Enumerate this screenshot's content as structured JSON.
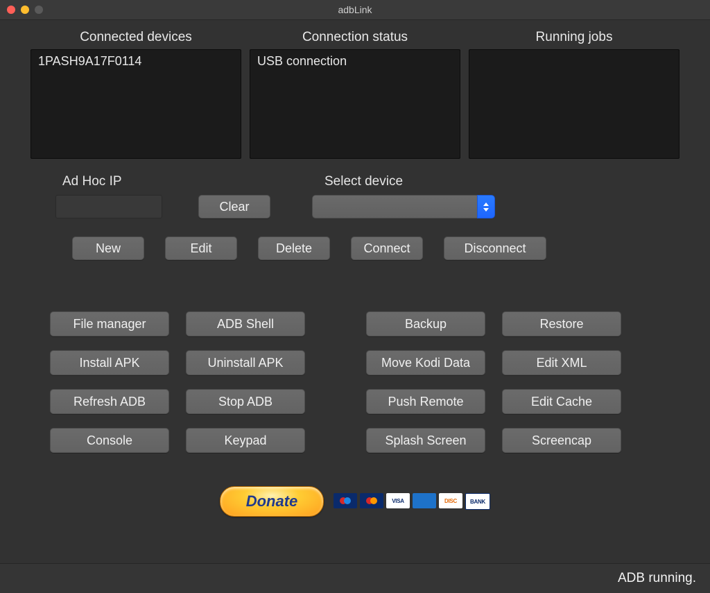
{
  "window": {
    "title": "adbLink"
  },
  "panels": {
    "connected": {
      "heading": "Connected devices",
      "content": "1PASH9A17F0114"
    },
    "status": {
      "heading": "Connection status",
      "content": "USB connection"
    },
    "jobs": {
      "heading": "Running jobs",
      "content": ""
    }
  },
  "adhoc": {
    "label": "Ad Hoc IP",
    "value": "",
    "clear": "Clear"
  },
  "select_device": {
    "label": "Select device",
    "value": ""
  },
  "device_actions": {
    "new": "New",
    "edit": "Edit",
    "delete": "Delete",
    "connect": "Connect",
    "disconnect": "Disconnect"
  },
  "tools_left": [
    [
      "File manager",
      "ADB Shell"
    ],
    [
      "Install APK",
      "Uninstall APK"
    ],
    [
      "Refresh ADB",
      "Stop ADB"
    ],
    [
      "Console",
      "Keypad"
    ]
  ],
  "tools_right": [
    [
      "Backup",
      "Restore"
    ],
    [
      "Move Kodi Data",
      "Edit XML"
    ],
    [
      "Push Remote",
      "Edit Cache"
    ],
    [
      "Splash Screen",
      "Screencap"
    ]
  ],
  "donate": {
    "label": "Donate",
    "cards": [
      "Maestro",
      "Mastercard",
      "VISA",
      "Amex",
      "Discover",
      "Bank"
    ]
  },
  "statusbar": "ADB running."
}
